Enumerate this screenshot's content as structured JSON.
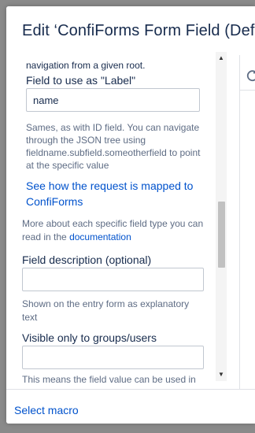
{
  "dialog": {
    "title": "Edit ‘ConfiForms Form Field (Defi"
  },
  "form": {
    "intro_text": "navigation from a given root.",
    "label_field": {
      "label": "Field to use as \"Label\"",
      "value": "name",
      "help_lines": [
        "Sames, as with ID field. You can navigate",
        "through the JSON tree using",
        "fieldname.subfield.someotherfield to point",
        "at the specific value"
      ]
    },
    "mapping_link_lines": [
      "See how the request is mapped to",
      "ConfiForms"
    ],
    "more_about_line1": "More about each specific field type you can",
    "more_about_line2_prefix": "read in the",
    "documentation_link": "documentation",
    "description_field": {
      "label": "Field description (optional)",
      "value": "",
      "help_lines": [
        "Shown on the entry form as explanatory",
        "text"
      ]
    },
    "visible_field": {
      "label": "Visible only to groups/users",
      "value": "",
      "help_text": "This means the field value can be used in"
    }
  },
  "scrollbar": {
    "up_icon": "triangle-up-icon",
    "down_icon": "triangle-down-icon"
  },
  "preview": {
    "refresh_icon": "refresh-icon"
  },
  "footer": {
    "select_macro": "Select macro"
  },
  "colors": {
    "link": "#0052cc",
    "text": "#172b4d",
    "muted": "#5e6c84",
    "border": "#dfe1e6",
    "backdrop": "#8a8a8a"
  }
}
